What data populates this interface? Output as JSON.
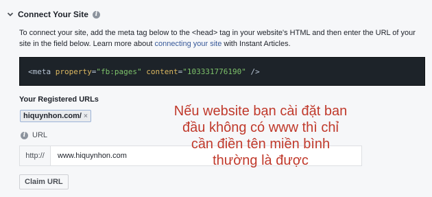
{
  "section": {
    "title": "Connect Your Site"
  },
  "description": {
    "text_before": "To connect your site, add the meta tag below to the <head> tag in your website's HTML and then enter the URL of your site in the field below. Learn more about ",
    "link_text": "connecting your site",
    "text_after": " with Instant Articles."
  },
  "code": {
    "open": "<meta ",
    "attr1": "property",
    "eq1": "=",
    "val1": "\"fb:pages\"",
    "space": " ",
    "attr2": "content",
    "eq2": "=",
    "val2": "\"103331776190\"",
    "close": " />"
  },
  "registered_urls": {
    "label": "Your Registered URLs",
    "items": [
      "hiquynhon.com/"
    ],
    "remove_glyph": "×"
  },
  "url_field": {
    "label": "URL",
    "prefix": "http://",
    "value": "www.hiquynhon.com"
  },
  "claim_button": {
    "label": "Claim URL"
  },
  "overlay_note": {
    "lines": [
      "Nếu website bạn cài đặt ban",
      "đầu không có www thì chỉ",
      "cần điền tên miền bình",
      "thường là được"
    ]
  },
  "icons": {
    "chevron": "chevron-down-icon",
    "info": "info-icon",
    "remove": "close-icon"
  },
  "colors": {
    "link": "#365899",
    "code_bg": "#1d2329",
    "code_attr": "#dcb860",
    "code_string": "#7dc26a",
    "overlay_text": "#c0392b"
  }
}
